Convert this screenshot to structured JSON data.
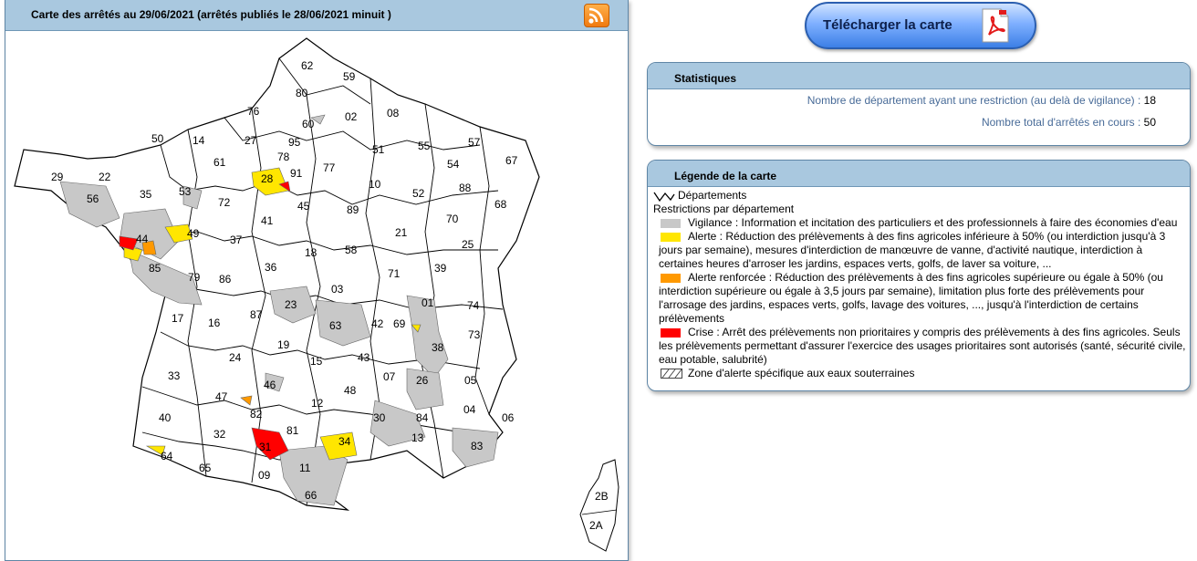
{
  "map": {
    "title": "Carte des arrêtés au 29/06/2021 (arrêtés publiés le 28/06/2021 minuit )",
    "rss_icon": "rss-icon",
    "departments": [
      {
        "code": "62",
        "level": "none"
      },
      {
        "code": "59",
        "level": "none"
      },
      {
        "code": "80",
        "level": "none"
      },
      {
        "code": "76",
        "level": "none"
      },
      {
        "code": "60",
        "level": "vigilance"
      },
      {
        "code": "02",
        "level": "none"
      },
      {
        "code": "08",
        "level": "none"
      },
      {
        "code": "50",
        "level": "none"
      },
      {
        "code": "14",
        "level": "none"
      },
      {
        "code": "27",
        "level": "none"
      },
      {
        "code": "95",
        "level": "none"
      },
      {
        "code": "57",
        "level": "none"
      },
      {
        "code": "51",
        "level": "none"
      },
      {
        "code": "55",
        "level": "none"
      },
      {
        "code": "78",
        "level": "none"
      },
      {
        "code": "91",
        "level": "none"
      },
      {
        "code": "61",
        "level": "none"
      },
      {
        "code": "77",
        "level": "none"
      },
      {
        "code": "67",
        "level": "none"
      },
      {
        "code": "54",
        "level": "none"
      },
      {
        "code": "29",
        "level": "none"
      },
      {
        "code": "22",
        "level": "none"
      },
      {
        "code": "28",
        "level": "alerte"
      },
      {
        "code": "10",
        "level": "none"
      },
      {
        "code": "88",
        "level": "none"
      },
      {
        "code": "56",
        "level": "vigilance"
      },
      {
        "code": "35",
        "level": "none"
      },
      {
        "code": "53",
        "level": "vigilance"
      },
      {
        "code": "72",
        "level": "none"
      },
      {
        "code": "52",
        "level": "none"
      },
      {
        "code": "45",
        "level": "none"
      },
      {
        "code": "89",
        "level": "none"
      },
      {
        "code": "68",
        "level": "none"
      },
      {
        "code": "70",
        "level": "none"
      },
      {
        "code": "41",
        "level": "none"
      },
      {
        "code": "44",
        "level": "crise"
      },
      {
        "code": "49",
        "level": "alerte"
      },
      {
        "code": "37",
        "level": "none"
      },
      {
        "code": "21",
        "level": "none"
      },
      {
        "code": "25",
        "level": "none"
      },
      {
        "code": "18",
        "level": "none"
      },
      {
        "code": "58",
        "level": "none"
      },
      {
        "code": "85",
        "level": "vigilance"
      },
      {
        "code": "79",
        "level": "vigilance"
      },
      {
        "code": "86",
        "level": "none"
      },
      {
        "code": "36",
        "level": "none"
      },
      {
        "code": "71",
        "level": "none"
      },
      {
        "code": "39",
        "level": "none"
      },
      {
        "code": "03",
        "level": "none"
      },
      {
        "code": "01",
        "level": "vigilance"
      },
      {
        "code": "74",
        "level": "none"
      },
      {
        "code": "23",
        "level": "vigilance"
      },
      {
        "code": "63",
        "level": "vigilance"
      },
      {
        "code": "42",
        "level": "none"
      },
      {
        "code": "69",
        "level": "alerte"
      },
      {
        "code": "87",
        "level": "none"
      },
      {
        "code": "17",
        "level": "none"
      },
      {
        "code": "16",
        "level": "none"
      },
      {
        "code": "73",
        "level": "none"
      },
      {
        "code": "38",
        "level": "vigilance"
      },
      {
        "code": "19",
        "level": "none"
      },
      {
        "code": "24",
        "level": "none"
      },
      {
        "code": "15",
        "level": "none"
      },
      {
        "code": "43",
        "level": "none"
      },
      {
        "code": "33",
        "level": "none"
      },
      {
        "code": "26",
        "level": "vigilance"
      },
      {
        "code": "05",
        "level": "none"
      },
      {
        "code": "07",
        "level": "none"
      },
      {
        "code": "46",
        "level": "vigilance"
      },
      {
        "code": "48",
        "level": "none"
      },
      {
        "code": "47",
        "level": "alerte_renforcee"
      },
      {
        "code": "12",
        "level": "none"
      },
      {
        "code": "84",
        "level": "vigilance"
      },
      {
        "code": "04",
        "level": "none"
      },
      {
        "code": "06",
        "level": "none"
      },
      {
        "code": "40",
        "level": "none"
      },
      {
        "code": "82",
        "level": "crise"
      },
      {
        "code": "30",
        "level": "vigilance"
      },
      {
        "code": "81",
        "level": "vigilance"
      },
      {
        "code": "13",
        "level": "vigilance"
      },
      {
        "code": "32",
        "level": "none"
      },
      {
        "code": "34",
        "level": "alerte"
      },
      {
        "code": "83",
        "level": "vigilance"
      },
      {
        "code": "31",
        "level": "crise"
      },
      {
        "code": "64",
        "level": "alerte"
      },
      {
        "code": "65",
        "level": "none"
      },
      {
        "code": "11",
        "level": "vigilance"
      },
      {
        "code": "09",
        "level": "none"
      },
      {
        "code": "66",
        "level": "vigilance"
      },
      {
        "code": "2B",
        "level": "none"
      },
      {
        "code": "2A",
        "level": "none"
      }
    ]
  },
  "download": {
    "label": "Télécharger la carte",
    "icon": "pdf-icon"
  },
  "stats": {
    "title": "Statistiques",
    "rows": [
      {
        "label": "Nombre de département ayant une restriction (au delà de vigilance) : ",
        "value": "18"
      },
      {
        "label": "Nombre total d'arrêtés en cours : ",
        "value": "50"
      }
    ]
  },
  "legend": {
    "title": "Légende de la carte",
    "departments_label": "Départements",
    "restrictions_label": "Restrictions par département",
    "items": [
      {
        "key": "vigilance",
        "color": "#c8c8c8",
        "text": "Vigilance : Information et incitation des particuliers et des professionnels à faire des économies d'eau"
      },
      {
        "key": "alerte",
        "color": "#ffe600",
        "text": "Alerte : Réduction des prélèvements à des fins agricoles inférieure à 50% (ou interdiction jusqu'à 3 jours par semaine), mesures d'interdiction de manœuvre de vanne, d'activité nautique, interdiction à certaines heures d'arroser les jardins, espaces verts, golfs, de laver sa voiture, ..."
      },
      {
        "key": "alerte_renforcee",
        "color": "#ff9900",
        "text": "Alerte renforcée : Réduction des prélèvements à des fins agricoles supérieure ou égale à 50% (ou interdiction supérieure ou égale à 3,5 jours par semaine), limitation plus forte des prélèvements pour l'arrosage des jardins, espaces verts, golfs, lavage des voitures, ..., jusqu'à l'interdiction de certains prélèvements"
      },
      {
        "key": "crise",
        "color": "#ff0000",
        "text": "Crise : Arrêt des prélèvements non prioritaires y compris des prélèvements à des fins agricoles. Seuls les prélèvements permettant d'assurer l'exercice des usages prioritaires sont autorisés (santé, sécurité civile, eau potable, salubrité)"
      }
    ],
    "groundwater_label": "Zone d'alerte spécifique aux eaux souterraines"
  },
  "colors": {
    "header_bg": "#a9c8df",
    "border": "#5f86a6",
    "vigilance": "#c8c8c8",
    "alerte": "#ffe600",
    "alerte_renforcee": "#ff9900",
    "crise": "#ff0000"
  }
}
